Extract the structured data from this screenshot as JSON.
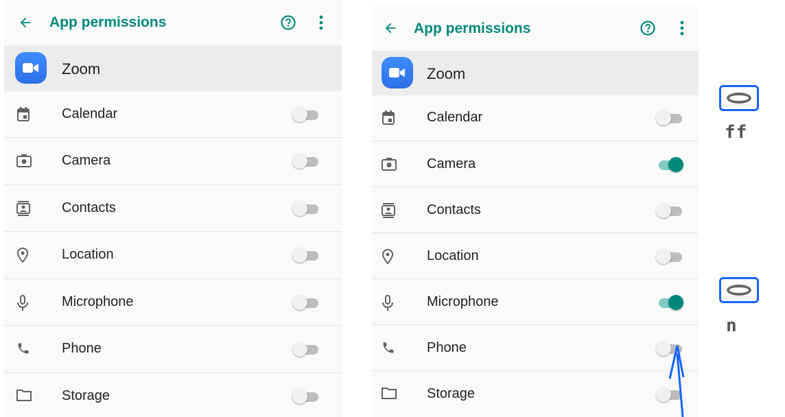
{
  "left_panel": {
    "header": {
      "title": "App permissions",
      "back_icon": "arrow-left-icon",
      "help_icon": "help-circle-icon",
      "more_icon": "more-vert-icon"
    },
    "app": {
      "name": "Zoom",
      "icon": "zoom-video-icon"
    },
    "permissions": [
      {
        "label": "Calendar",
        "icon": "calendar-icon",
        "state": "off"
      },
      {
        "label": "Camera",
        "icon": "camera-icon",
        "state": "off"
      },
      {
        "label": "Contacts",
        "icon": "contacts-icon",
        "state": "off"
      },
      {
        "label": "Location",
        "icon": "location-icon",
        "state": "off"
      },
      {
        "label": "Microphone",
        "icon": "microphone-icon",
        "state": "off"
      },
      {
        "label": "Phone",
        "icon": "phone-icon",
        "state": "off"
      },
      {
        "label": "Storage",
        "icon": "folder-icon",
        "state": "off"
      }
    ]
  },
  "right_panel": {
    "header": {
      "title": "App permissions",
      "back_icon": "arrow-left-icon",
      "help_icon": "help-circle-icon",
      "more_icon": "more-vert-icon"
    },
    "app": {
      "name": "Zoom",
      "icon": "zoom-video-icon"
    },
    "permissions": [
      {
        "label": "Calendar",
        "icon": "calendar-icon",
        "state": "off"
      },
      {
        "label": "Camera",
        "icon": "camera-icon",
        "state": "on"
      },
      {
        "label": "Contacts",
        "icon": "contacts-icon",
        "state": "off"
      },
      {
        "label": "Location",
        "icon": "location-icon",
        "state": "off"
      },
      {
        "label": "Microphone",
        "icon": "microphone-icon",
        "state": "on"
      },
      {
        "label": "Phone",
        "icon": "phone-icon",
        "state": "off"
      },
      {
        "label": "Storage",
        "icon": "folder-icon",
        "state": "off"
      }
    ]
  },
  "annotations": {
    "off_label": "ff",
    "on_label": "n",
    "pointer": "arrow-pointer-icon"
  },
  "colors": {
    "accent": "#00897b",
    "switch_on_track": "#80cbc4",
    "switch_off_track": "#bdbdbd",
    "app_row_bg": "#ececec",
    "annotation_blue": "#1565ff"
  }
}
